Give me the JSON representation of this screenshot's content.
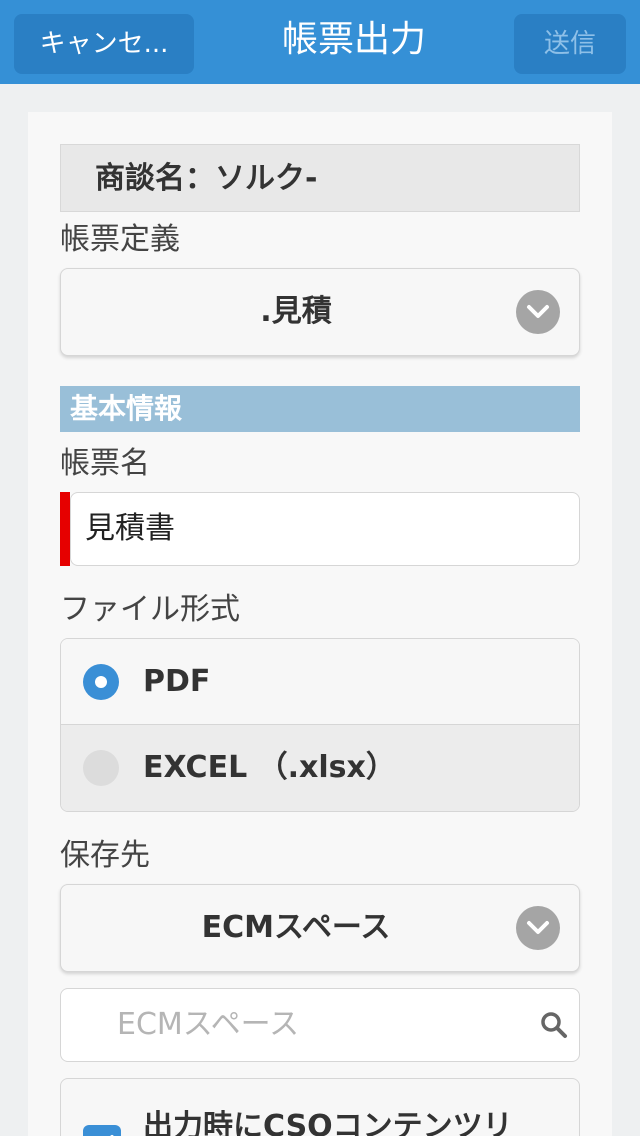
{
  "header": {
    "cancel_label": "キャンセ...",
    "title": "帳票出力",
    "send_label": "送信"
  },
  "form": {
    "deal_name": "商談名：ソルク-",
    "report_definition_label": "帳票定義",
    "report_definition_value": ".見積",
    "section_title": "基本情報",
    "report_name_label": "帳票名",
    "report_name_value": "見積書",
    "file_format_label": "ファイル形式",
    "file_format_options": [
      {
        "label": "PDF",
        "selected": true
      },
      {
        "label": "EXCEL （.xlsx）",
        "selected": false
      }
    ],
    "save_to_label": "保存先",
    "save_to_value": "ECMスペース",
    "search_placeholder": "ECMスペース",
    "checkbox_label": "出力時にCSOコンテンツリ",
    "checkbox_checked": true
  },
  "colors": {
    "header": "#3590d6",
    "accent": "#3a8fd6",
    "required": "#e60000",
    "section": "#99bfd8"
  },
  "icons": [
    "chevron-down-icon",
    "search-icon",
    "checkmark-icon"
  ]
}
